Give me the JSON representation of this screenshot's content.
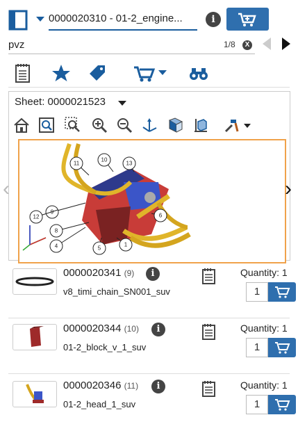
{
  "header": {
    "document_title": "0000020310 - 01-2_engine...",
    "info_icon": "i"
  },
  "search": {
    "value": "pvz",
    "count": "1/8",
    "clear_icon": "X"
  },
  "toolbar": {
    "icons": [
      "parts-list-icon",
      "star-icon",
      "tag-icon",
      "cart-icon",
      "binoculars-icon"
    ]
  },
  "viewer": {
    "sheet_label": "Sheet: 0000021523",
    "callouts": [
      "11",
      "10",
      "13",
      "9",
      "12",
      "8",
      "6",
      "4",
      "5",
      "1"
    ]
  },
  "parts": [
    {
      "number": "0000020341",
      "index": "(9)",
      "name": "v8_timi_chain_SN001_suv",
      "qty_label": "Quantity: 1",
      "qty": "1"
    },
    {
      "number": "0000020344",
      "index": "(10)",
      "name": "01-2_block_v_1_suv",
      "qty_label": "Quantity: 1",
      "qty": "1"
    },
    {
      "number": "0000020346",
      "index": "(11)",
      "name": "01-2_head_1_suv",
      "qty_label": "Quantity: 1",
      "qty": "1"
    }
  ],
  "colors": {
    "accent": "#2f6fae",
    "highlight": "#f0a24a"
  }
}
